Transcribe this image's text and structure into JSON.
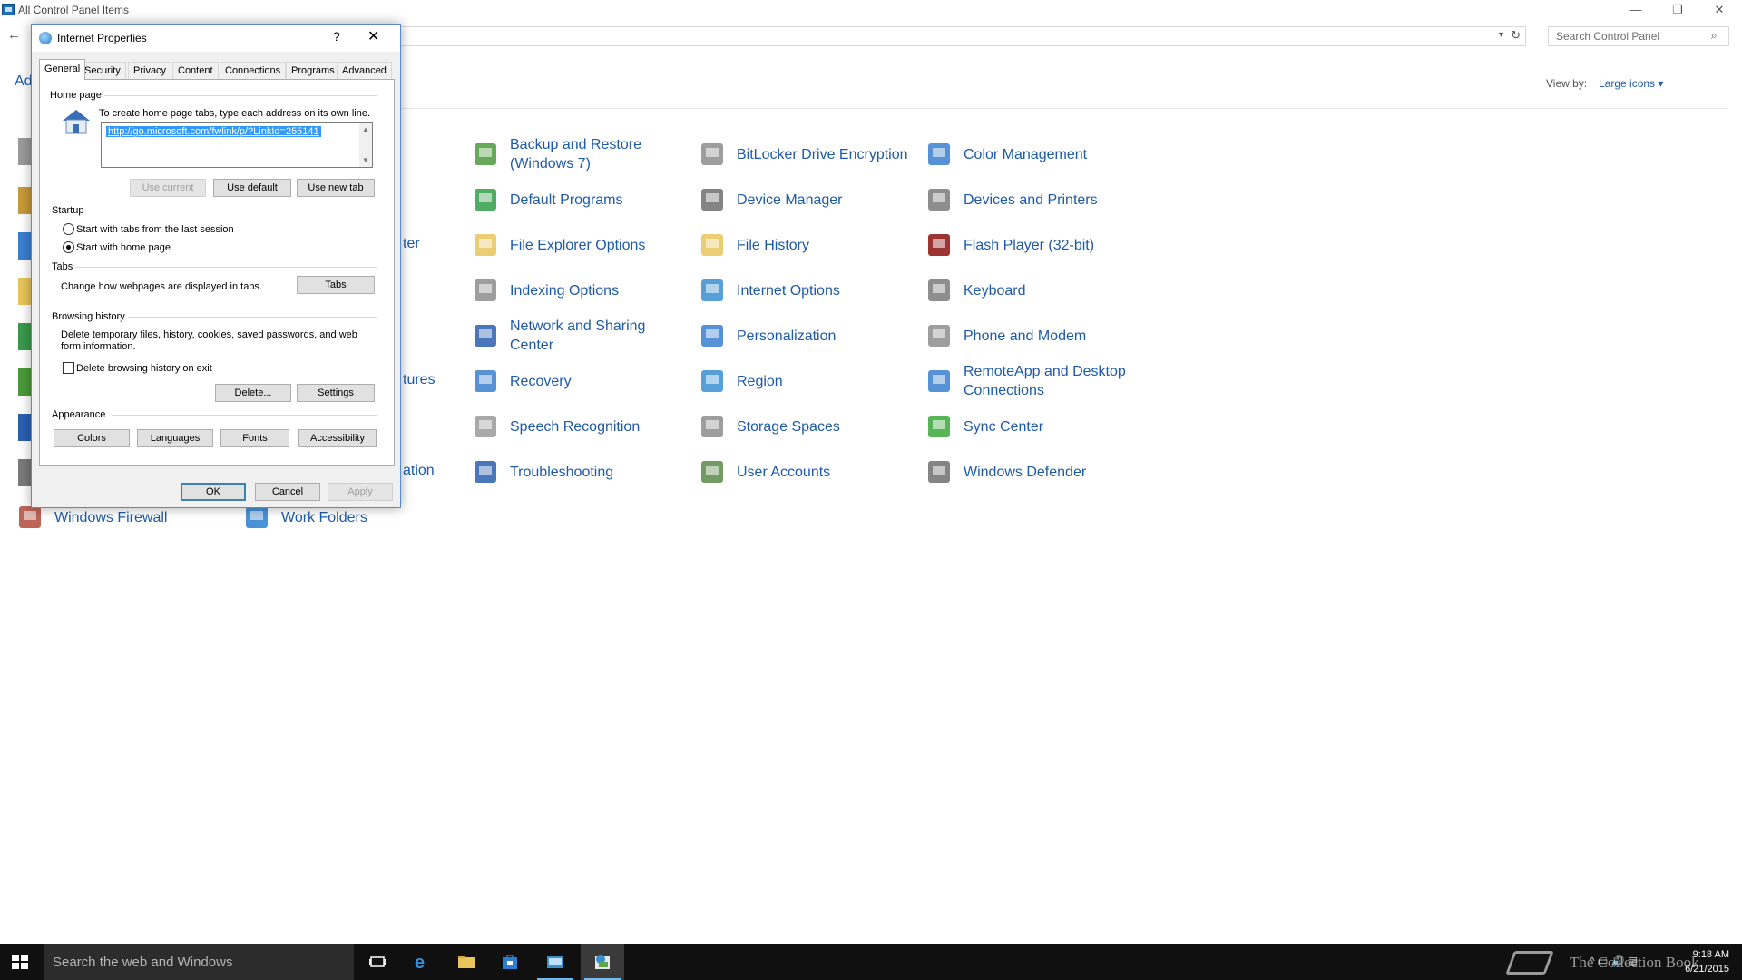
{
  "control_panel": {
    "title": "All Control Panel Items",
    "window_controls": {
      "minimize": "—",
      "maximize": "❐",
      "close": "✕"
    },
    "back": "←",
    "address_dropdown": "▾",
    "address_refresh": "↻",
    "search_placeholder": "Search Control Panel",
    "search_icon": "⌕",
    "adjust_text": "Ad",
    "view_by_label": "View by:",
    "view_by_value": "Large icons ▾",
    "clipped_labels": [
      "ter",
      "tures",
      "ation"
    ],
    "items": [
      {
        "label": "Backup and Restore\n(Windows 7)",
        "icon": "backup-icon",
        "color": "#4b9a3c"
      },
      {
        "label": "BitLocker Drive Encryption",
        "icon": "bitlocker-icon",
        "color": "#8d8d8d"
      },
      {
        "label": "Color Management",
        "icon": "color-management-icon",
        "color": "#3a7fd0"
      },
      {
        "label": "Default Programs",
        "icon": "default-programs-icon",
        "color": "#2f9e48"
      },
      {
        "label": "Device Manager",
        "icon": "device-manager-icon",
        "color": "#6f6f6f"
      },
      {
        "label": "Devices and Printers",
        "icon": "devices-printers-icon",
        "color": "#7a7a7a"
      },
      {
        "label": "File Explorer Options",
        "icon": "file-explorer-options-icon",
        "color": "#e8c45a"
      },
      {
        "label": "File History",
        "icon": "file-history-icon",
        "color": "#e8c45a"
      },
      {
        "label": "Flash Player (32-bit)",
        "icon": "flash-player-icon",
        "color": "#8b1111"
      },
      {
        "label": "Indexing Options",
        "icon": "indexing-options-icon",
        "color": "#8d8d8d"
      },
      {
        "label": "Internet Options",
        "icon": "internet-options-icon",
        "color": "#3a8fd0"
      },
      {
        "label": "Keyboard",
        "icon": "keyboard-icon",
        "color": "#7a7a7a"
      },
      {
        "label": "Network and Sharing\nCenter",
        "icon": "network-sharing-icon",
        "color": "#2a5fb0"
      },
      {
        "label": "Personalization",
        "icon": "personalization-icon",
        "color": "#3a7fd0"
      },
      {
        "label": "Phone and Modem",
        "icon": "phone-modem-icon",
        "color": "#8d8d8d"
      },
      {
        "label": "Recovery",
        "icon": "recovery-icon",
        "color": "#3a7fd0"
      },
      {
        "label": "Region",
        "icon": "region-icon",
        "color": "#3a8fd0"
      },
      {
        "label": "RemoteApp and Desktop\nConnections",
        "icon": "remoteapp-icon",
        "color": "#3a7fd0"
      },
      {
        "label": "Speech Recognition",
        "icon": "speech-recognition-icon",
        "color": "#9a9a9a"
      },
      {
        "label": "Storage Spaces",
        "icon": "storage-spaces-icon",
        "color": "#8d8d8d"
      },
      {
        "label": "Sync Center",
        "icon": "sync-center-icon",
        "color": "#3aa83a"
      },
      {
        "label": "Troubleshooting",
        "icon": "troubleshooting-icon",
        "color": "#2a5fb0"
      },
      {
        "label": "User Accounts",
        "icon": "user-accounts-icon",
        "color": "#5a8a4a"
      },
      {
        "label": "Windows Defender",
        "icon": "windows-defender-icon",
        "color": "#6f6f6f"
      },
      {
        "label": "Windows Firewall",
        "icon": "windows-firewall-icon",
        "color": "#b04a3a"
      },
      {
        "label": "Work Folders",
        "icon": "work-folders-icon",
        "color": "#2a7fd0"
      }
    ]
  },
  "dialog": {
    "title": "Internet Properties",
    "help": "?",
    "close": "✕",
    "tabs": [
      "General",
      "Security",
      "Privacy",
      "Content",
      "Connections",
      "Programs",
      "Advanced"
    ],
    "active_tab": "General",
    "home_page": {
      "label": "Home page",
      "instruction": "To create home page tabs, type each address on its own line.",
      "url": "http://go.microsoft.com/fwlink/p/?LinkId=255141",
      "scroll_up": "▲",
      "scroll_down": "▼",
      "buttons": {
        "use_current": "Use current",
        "use_default": "Use default",
        "use_new_tab": "Use new tab"
      }
    },
    "startup": {
      "label": "Startup",
      "option_last_session": "Start with tabs from the last session",
      "option_home_page": "Start with home page",
      "selected": "home_page"
    },
    "tabs_group": {
      "label": "Tabs",
      "text": "Change how webpages are displayed in tabs.",
      "button": "Tabs"
    },
    "browsing_history": {
      "label": "Browsing history",
      "text": "Delete temporary files, history, cookies, saved passwords, and web form information.",
      "checkbox": "Delete browsing history on exit",
      "checked": false,
      "delete_button": "Delete...",
      "settings_button": "Settings"
    },
    "appearance": {
      "label": "Appearance",
      "colors": "Colors",
      "languages": "Languages",
      "fonts": "Fonts",
      "accessibility": "Accessibility"
    },
    "footer": {
      "ok": "OK",
      "cancel": "Cancel",
      "apply": "Apply"
    }
  },
  "taskbar": {
    "search_text": "Search the web and Windows",
    "apps": [
      "task-view-icon",
      "edge-icon",
      "file-explorer-icon",
      "store-icon",
      "control-panel-icon",
      "internet-properties-icon"
    ],
    "watermark": "The Collection Book",
    "tray": "^  ▭  🔊  ▤",
    "time": "9:18 AM",
    "date": "6/21/2015"
  }
}
